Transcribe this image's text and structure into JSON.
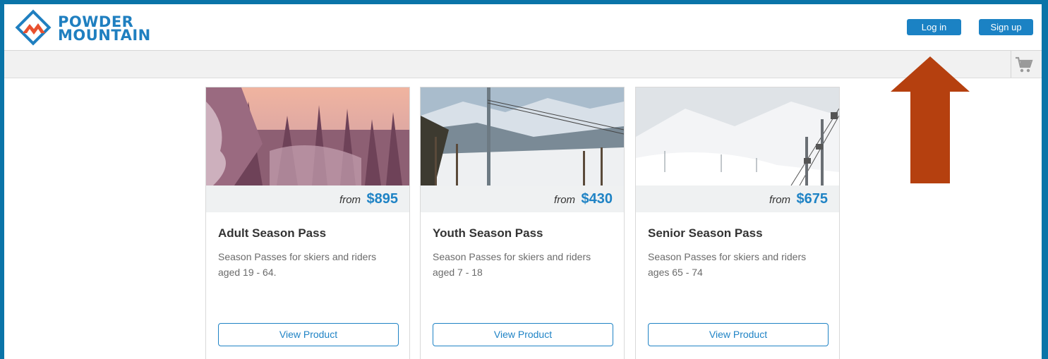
{
  "brand": {
    "line1": "POWDER",
    "line2": "MOUNTAIN"
  },
  "header": {
    "login_label": "Log in",
    "signup_label": "Sign up"
  },
  "colors": {
    "accent": "#1f83c5",
    "frame": "#0a74a8",
    "arrow": "#b5400f",
    "logo_red": "#e8502e"
  },
  "products": [
    {
      "from_label": "from",
      "price": "$895",
      "title": "Adult Season Pass",
      "description": "Season Passes for skiers and riders aged 19 - 64.",
      "button_label": "View Product"
    },
    {
      "from_label": "from",
      "price": "$430",
      "title": "Youth Season Pass",
      "description": "Season Passes for skiers and riders aged 7 - 18",
      "button_label": "View Product"
    },
    {
      "from_label": "from",
      "price": "$675",
      "title": "Senior Season Pass",
      "description": "Season Passes for skiers and riders ages 65 - 74",
      "button_label": "View Product"
    }
  ],
  "icons": {
    "cart": "shopping-cart-icon",
    "annotation": "up-arrow-annotation"
  }
}
